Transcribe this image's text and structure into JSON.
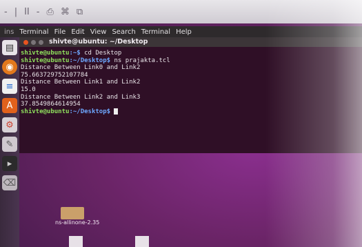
{
  "toolbar": {
    "glyphs": [
      "-",
      "|",
      "II",
      "-",
      "⎙",
      "⌘",
      "⧉"
    ]
  },
  "menubar": {
    "prefix": "ins",
    "items": [
      "Terminal",
      "File",
      "Edit",
      "View",
      "Search",
      "Terminal",
      "Help"
    ]
  },
  "terminal": {
    "title": "shivte@ubuntu: ~/Desktop",
    "lines": [
      {
        "user": "shivte@ubuntu",
        "path": ":~$",
        "cmd": " cd Desktop"
      },
      {
        "user": "shivte@ubuntu",
        "path": ":~/Desktop$",
        "cmd": " ns prajakta.tcl"
      },
      {
        "text": "Distance Between Link0 and Link2"
      },
      {
        "text": "75.663729752107784"
      },
      {
        "text": "Distance Between Link1 and Link2"
      },
      {
        "text": "15.0"
      },
      {
        "text": "Distance Between Link2 and Link3"
      },
      {
        "text": "37.8549864614954"
      },
      {
        "user": "shivte@ubuntu",
        "path": ":~/Desktop$",
        "cmd": " "
      }
    ]
  },
  "desktop": {
    "folder_label": "ns-allinone-2.35"
  },
  "colors": {
    "terminal_bg": "#2f0f26",
    "prompt_user": "#8fe05d",
    "prompt_path": "#6ea8ff",
    "desktop_purple": "#6a2466"
  }
}
